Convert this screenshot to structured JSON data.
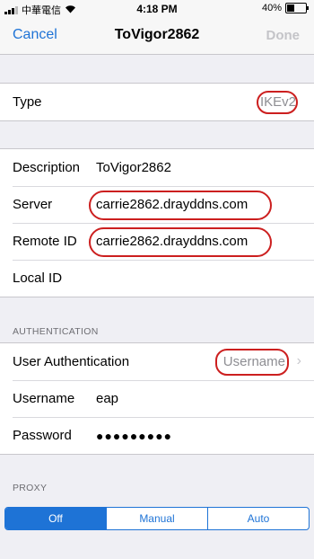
{
  "status_bar": {
    "carrier": "中華電信",
    "time": "4:18 PM",
    "battery": "40%",
    "battery_level": 0.4
  },
  "nav": {
    "cancel": "Cancel",
    "title": "ToVigor2862",
    "done": "Done"
  },
  "type_row": {
    "label": "Type",
    "value": "IKEv2"
  },
  "details": [
    {
      "label": "Description",
      "value": "ToVigor2862"
    },
    {
      "label": "Server",
      "value": "carrie2862.drayddns.com"
    },
    {
      "label": "Remote ID",
      "value": "carrie2862.drayddns.com"
    },
    {
      "label": "Local ID",
      "value": ""
    }
  ],
  "authentication": {
    "header": "AUTHENTICATION",
    "user_auth_label": "User Authentication",
    "user_auth_value": "Username",
    "username_label": "Username",
    "username_value": "eap",
    "password_label": "Password",
    "password_value": "●●●●●●●●●"
  },
  "proxy": {
    "header": "PROXY",
    "options": [
      "Off",
      "Manual",
      "Auto"
    ],
    "selected": "Off"
  },
  "colors": {
    "accent": "#1e73d6",
    "highlight": "#cc1f1f",
    "background": "#efeff4"
  }
}
